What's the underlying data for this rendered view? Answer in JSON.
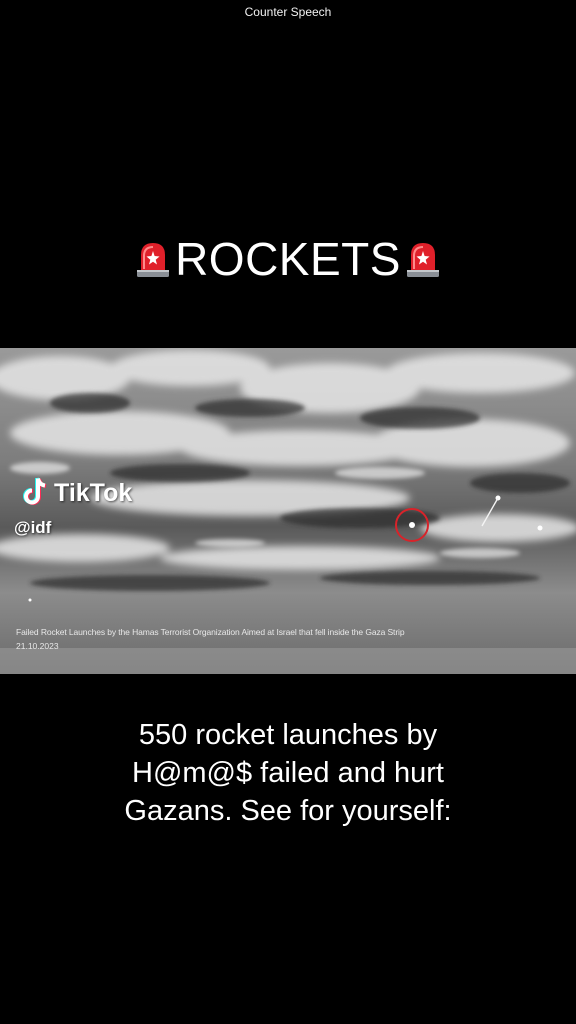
{
  "header": {
    "label": "Counter Speech"
  },
  "headline": {
    "text": "ROCKETS",
    "left_icon": "siren-icon",
    "right_icon": "siren-icon"
  },
  "video": {
    "watermark": {
      "brand": "TikTok",
      "handle": "@idf",
      "icon": "tiktok-logo-icon"
    },
    "caption": "Failed Rocket Launches by the Hamas Terrorist Organization Aimed at Israel that fell inside the Gaza Strip",
    "date": "21.10.2023",
    "marker_icon": "target-circle-icon"
  },
  "body": {
    "lines": [
      "550 rocket launches by",
      "H@m@$ failed and hurt",
      "Gazans. See for yourself:"
    ]
  },
  "colors": {
    "background": "#000000",
    "text": "#ffffff",
    "siren_red": "#e0202a",
    "marker_red": "#d8232a"
  }
}
